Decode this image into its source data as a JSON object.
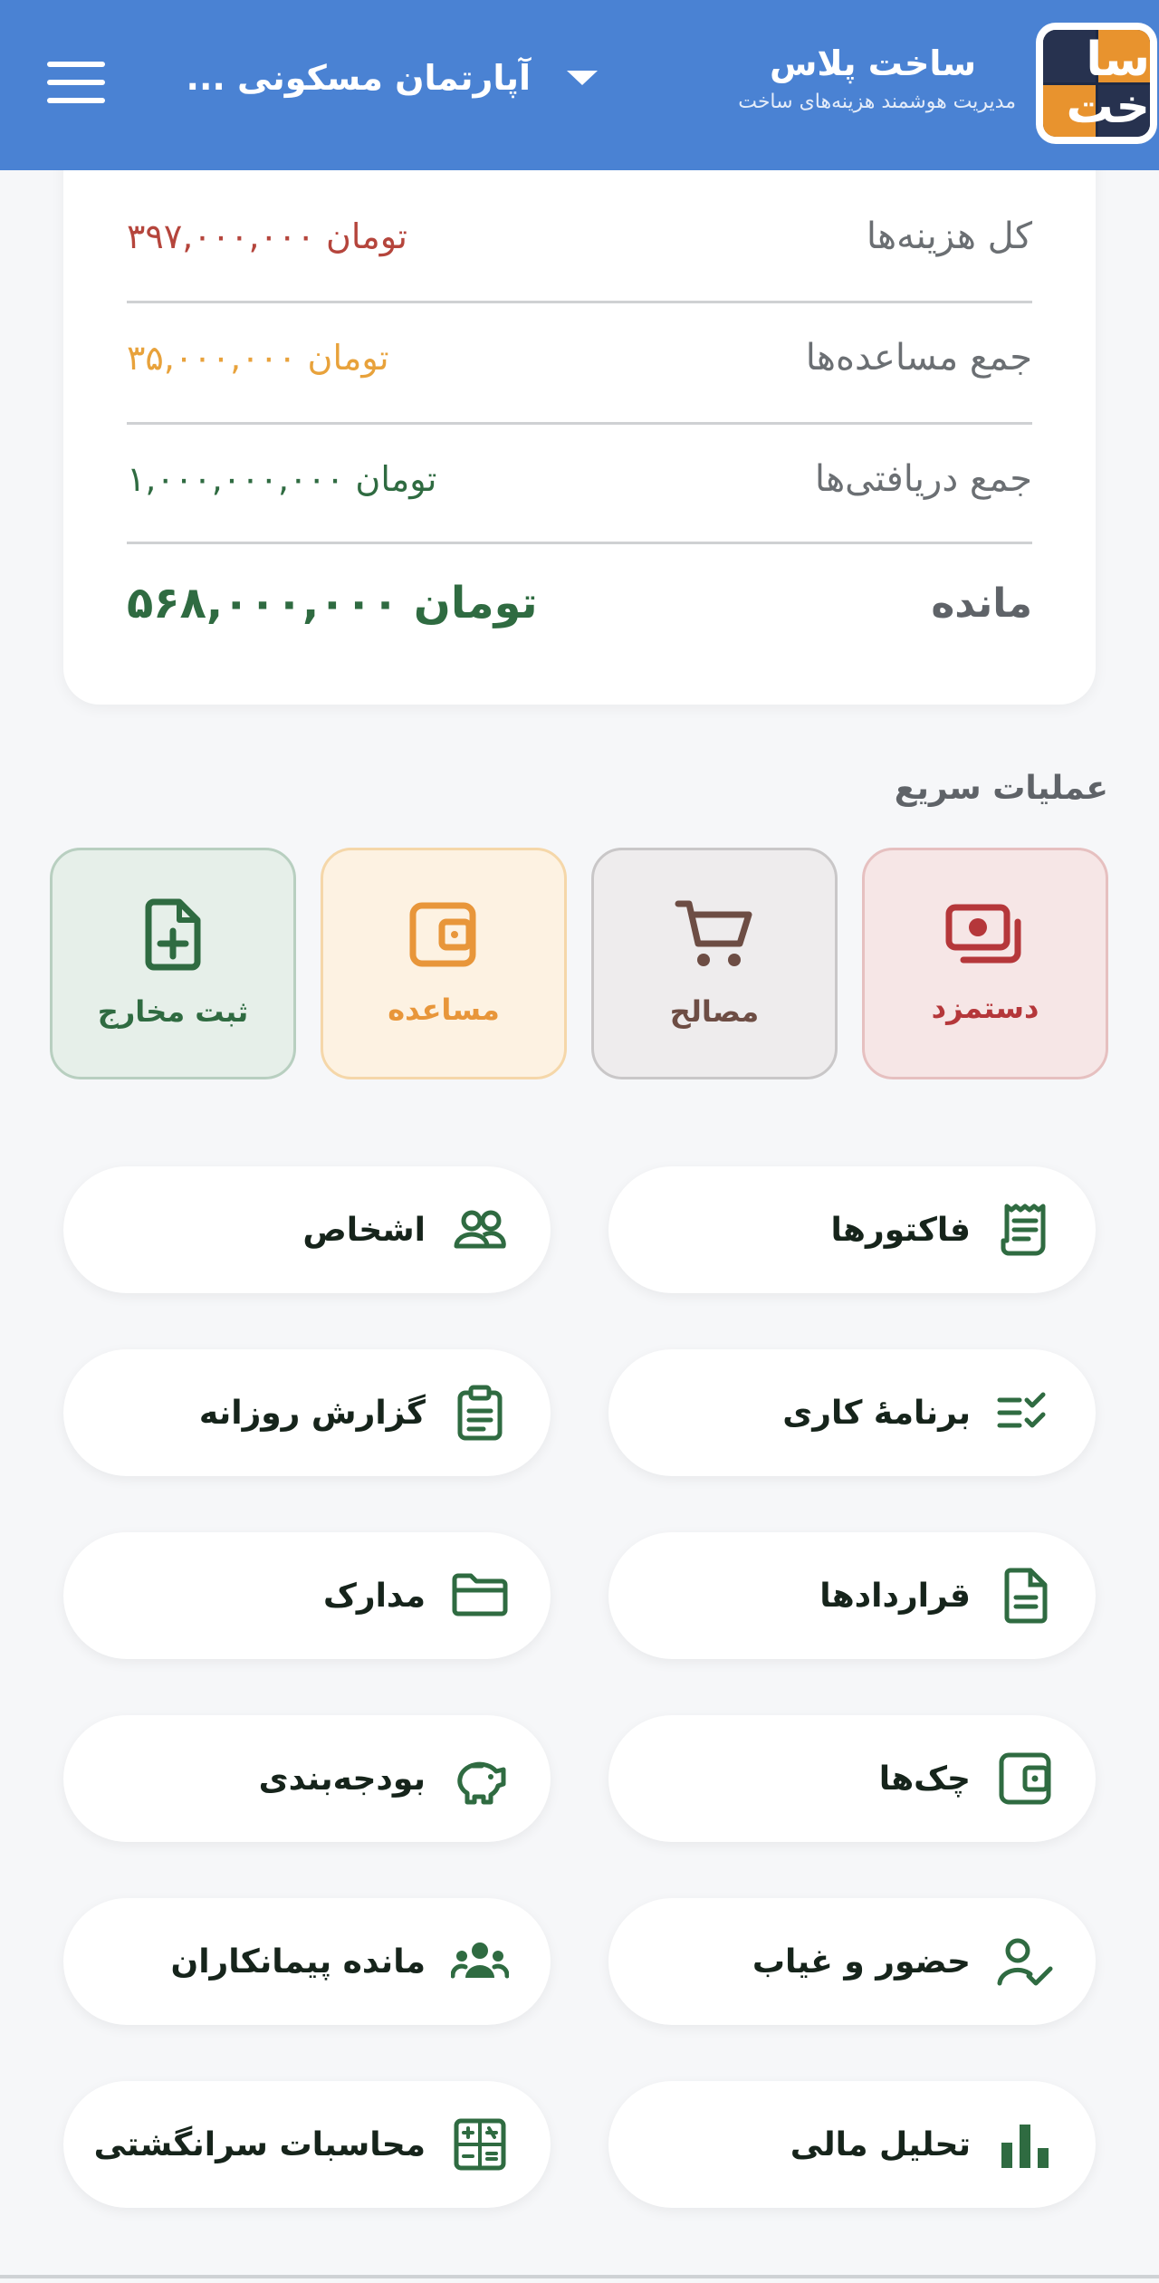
{
  "header": {
    "app_title": "ساخت پلاس",
    "app_subtitle": "مدیریت هوشمند هزینه‌های ساخت",
    "project_selected": "آپارتمان مسکونی ...",
    "logo_text": "سا خت",
    "colors": {
      "header_bg": "#4a82d3"
    }
  },
  "summary": {
    "total_expenses_label": "کل هزینه‌ها",
    "total_expenses_value": "۳۹۷,۰۰۰,۰۰۰ تومان",
    "total_advances_label": "جمع مساعده‌ها",
    "total_advances_value": "۳۵,۰۰۰,۰۰۰ تومان",
    "total_received_label": "جمع دریافتی‌ها",
    "total_received_value": "۱,۰۰۰,۰۰۰,۰۰۰ تومان",
    "balance_label": "مانده",
    "balance_value": "۵۶۸,۰۰۰,۰۰۰ تومان"
  },
  "quick_actions": {
    "title": "عملیات سریع",
    "items": [
      {
        "label": "دستمزد",
        "icon": "cash-icon",
        "color": "#b5373a"
      },
      {
        "label": "مصالح",
        "icon": "cart-icon",
        "color": "#6d4d44"
      },
      {
        "label": "مساعده",
        "icon": "wallet-icon",
        "color": "#e8963a"
      },
      {
        "label": "ثبت مخارج",
        "icon": "file-plus-icon",
        "color": "#2f6b41"
      }
    ]
  },
  "menu": {
    "items": [
      {
        "label": "فاکتورها",
        "icon": "receipt-icon"
      },
      {
        "label": "اشخاص",
        "icon": "people-icon"
      },
      {
        "label": "برنامهٔ کاری",
        "icon": "checklist-icon"
      },
      {
        "label": "گزارش روزانه",
        "icon": "clipboard-icon"
      },
      {
        "label": "قراردادها",
        "icon": "document-icon"
      },
      {
        "label": "مدارک",
        "icon": "folder-icon"
      },
      {
        "label": "چک‌ها",
        "icon": "wallet-icon"
      },
      {
        "label": "بودجه‌بندی",
        "icon": "piggy-bank-icon"
      },
      {
        "label": "حضور و غیاب",
        "icon": "user-check-icon"
      },
      {
        "label": "مانده پیمانکاران",
        "icon": "team-icon"
      },
      {
        "label": "تحلیل مالی",
        "icon": "bar-chart-icon"
      },
      {
        "label": "محاسبات سرانگشتی",
        "icon": "calculator-icon"
      }
    ],
    "icon_color": "#2f6b41"
  }
}
